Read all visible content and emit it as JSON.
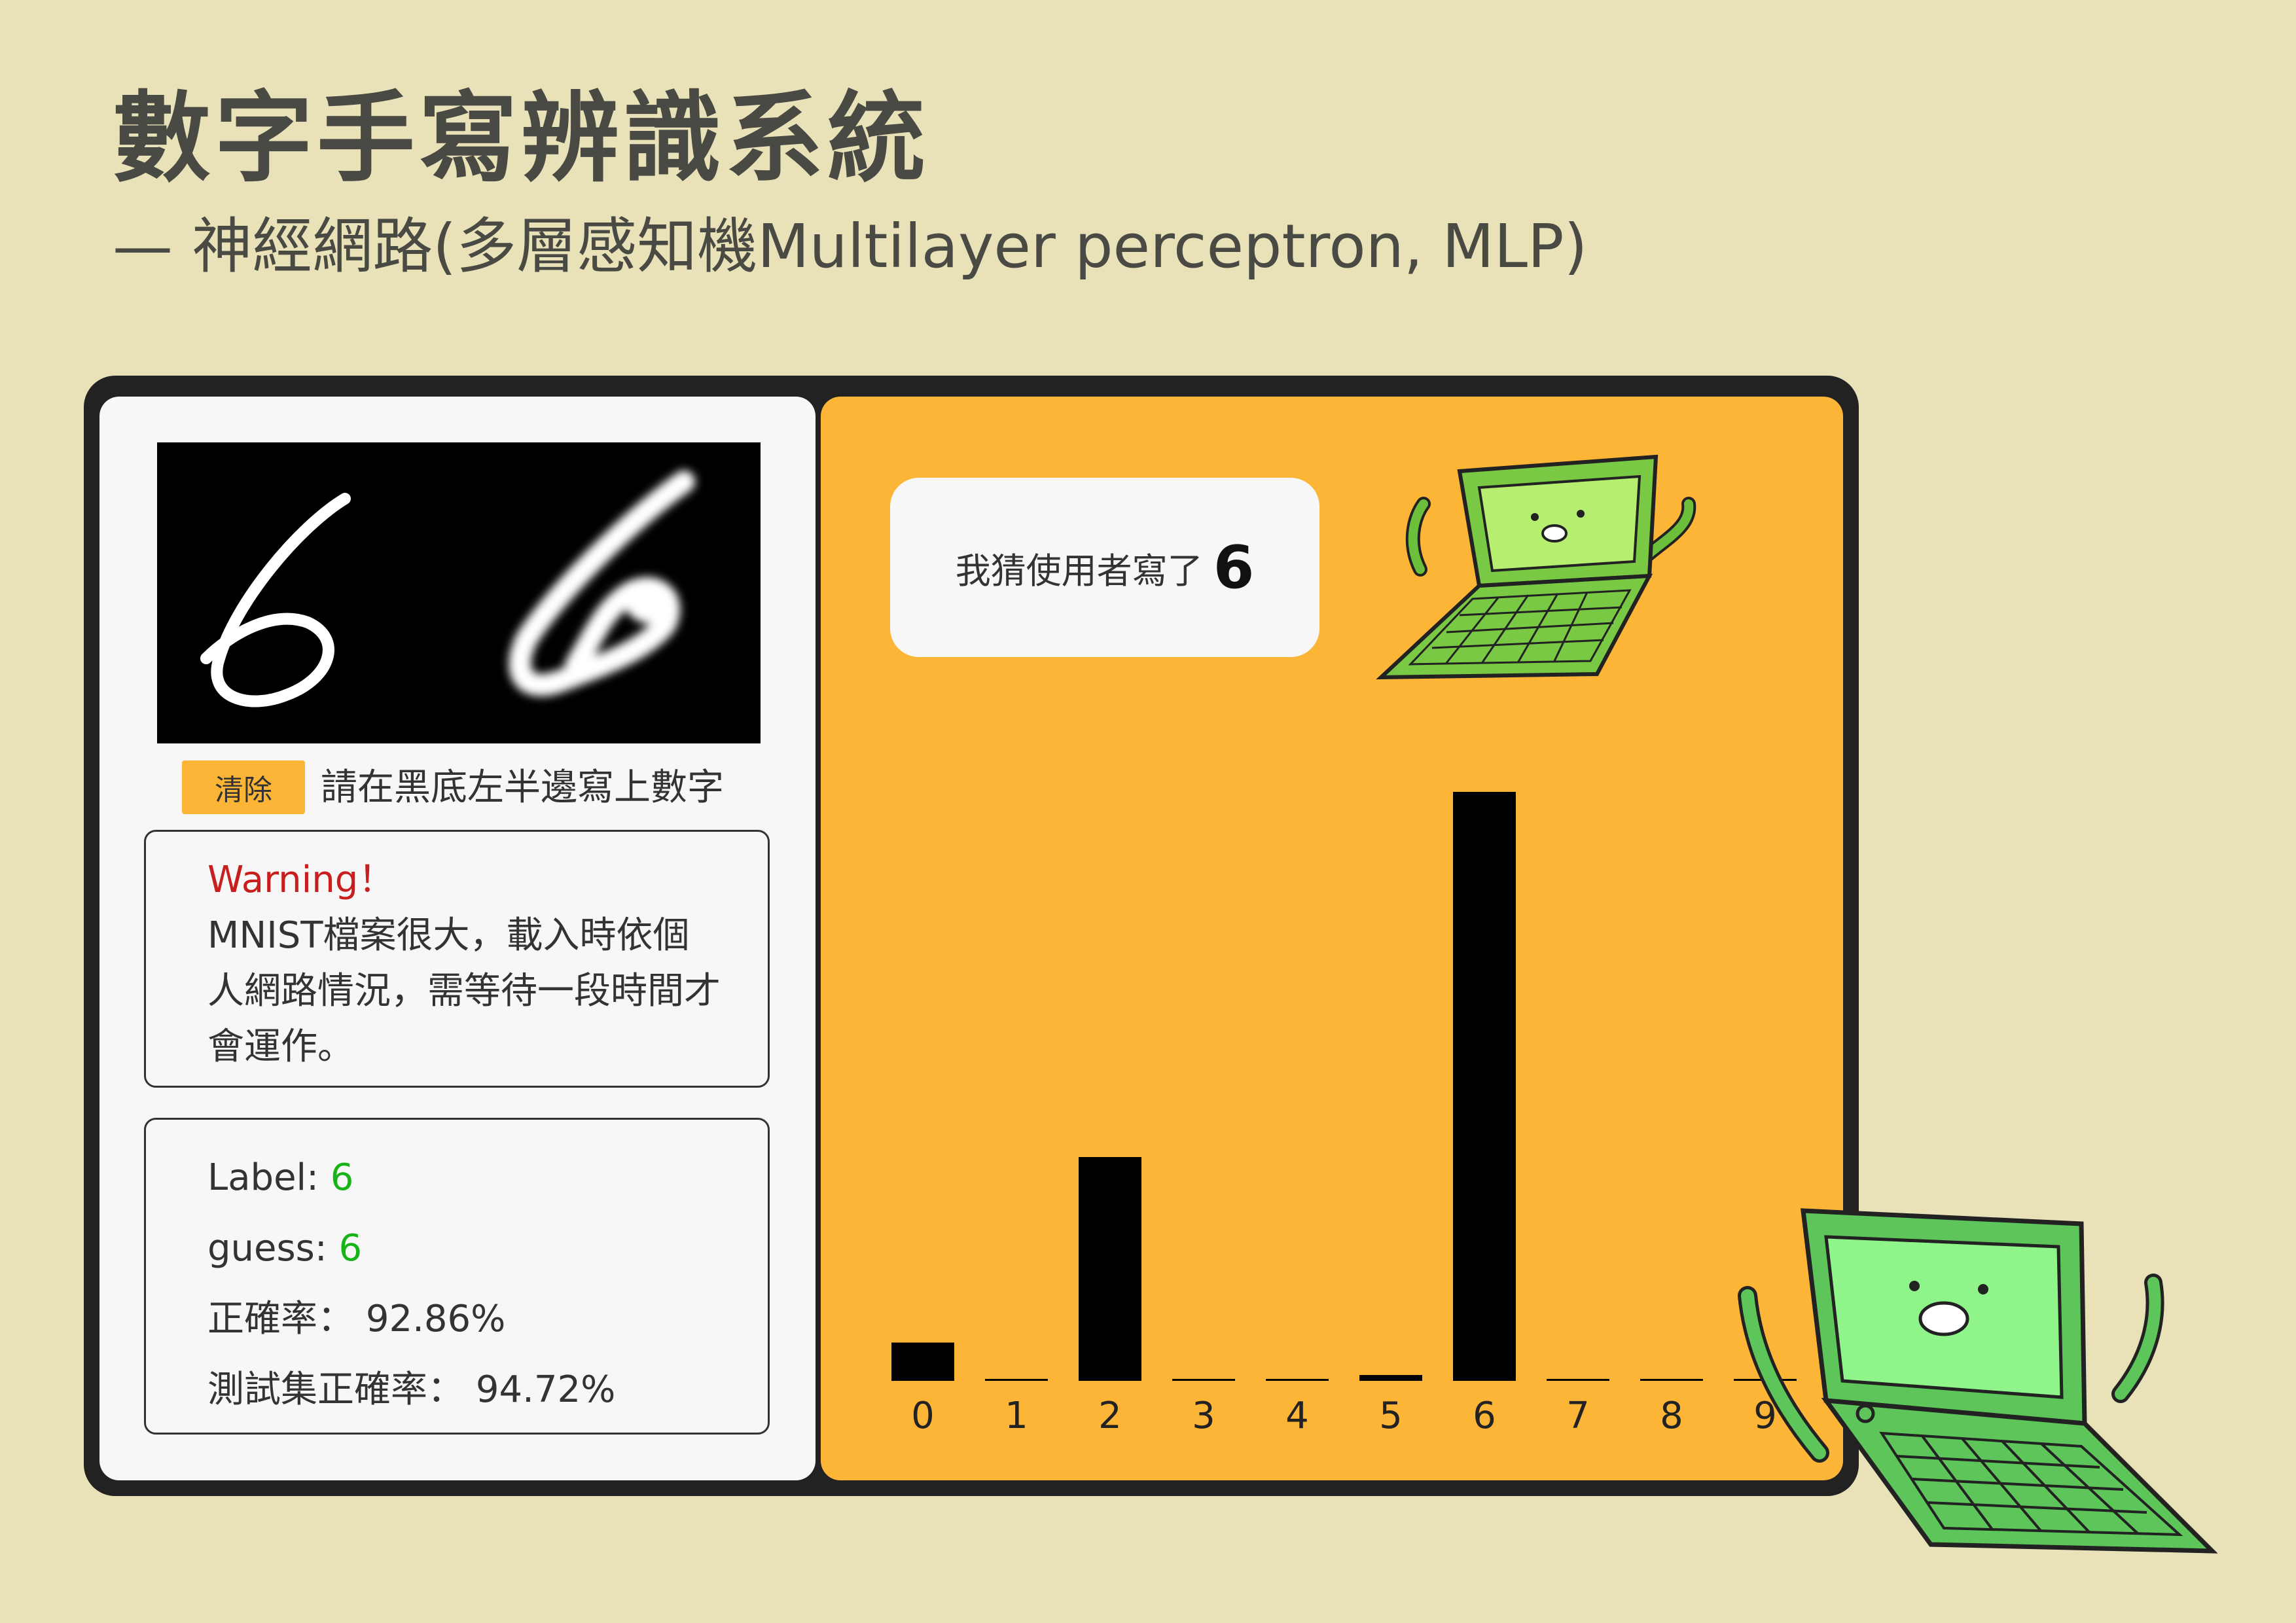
{
  "header": {
    "title": "數字手寫辨識系統",
    "subtitle": "— 神經網路(多層感知機Multilayer perceptron, MLP)"
  },
  "input_panel": {
    "clear_label": "清除",
    "instruction": "請在黑底左半邊寫上數字"
  },
  "warning": {
    "title": "Warning！",
    "text": "MNIST檔案很大，載入時依個人網路情況，需等待一段時間才會運作。"
  },
  "stats": {
    "label_text": "Label: ",
    "label_value": "6",
    "guess_text": "guess: ",
    "guess_value": "6",
    "accuracy_text": "正確率：",
    "accuracy_value": "92.86%",
    "test_accuracy_text": "測試集正確率：",
    "test_accuracy_value": "94.72%"
  },
  "prediction": {
    "text": "我猜使用者寫了",
    "value": "6"
  },
  "colors": {
    "background": "#e9e2b9",
    "accent": "#fdb537",
    "correct_green": "#17b317",
    "warning_red": "#c81e1e"
  },
  "chart_data": {
    "type": "bar",
    "categories": [
      "0",
      "1",
      "2",
      "3",
      "4",
      "5",
      "6",
      "7",
      "8",
      "9"
    ],
    "values": [
      0.065,
      0.003,
      0.38,
      0.003,
      0.003,
      0.01,
      1.0,
      0.003,
      0.003,
      0.003
    ],
    "ylim": [
      0,
      1.0
    ],
    "grid": false,
    "title": "",
    "xlabel": "",
    "ylabel": ""
  }
}
